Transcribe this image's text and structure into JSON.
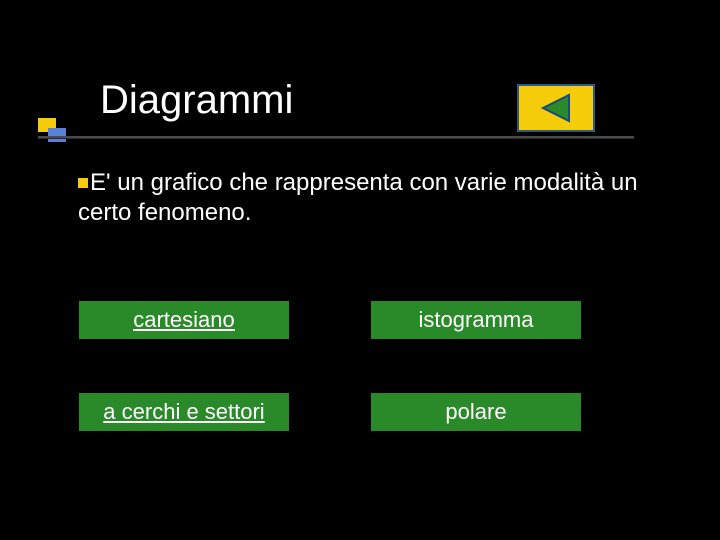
{
  "title": "Diagrammi",
  "body_text": "E' un grafico che rappresenta con varie modalità un certo fenomeno.",
  "nav": {
    "back_icon": "triangle-left"
  },
  "options": {
    "cartesiano": "cartesiano",
    "istogramma": "istogramma",
    "a_cerchi_e_settori": "a cerchi e settori",
    "polare": "polare"
  },
  "colors": {
    "accent_yellow": "#f5cc0a",
    "accent_blue": "#5b7fd6",
    "button_green": "#2a8a2a"
  }
}
